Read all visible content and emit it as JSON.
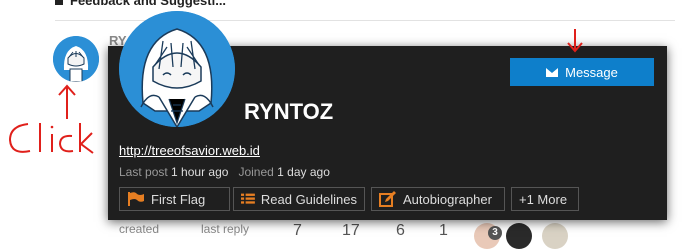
{
  "topic": {
    "title": "Feedback and Suggesti..."
  },
  "background_post": {
    "username_partial": "RY",
    "stats": {
      "created_label": "created",
      "last_reply_label": "last reply",
      "replies": "7",
      "views": "17",
      "users": "6",
      "likes": "1",
      "badge_count": "3"
    }
  },
  "user_card": {
    "username": "RYNTOZ",
    "message_button": "Message",
    "website": "http://treeofsavior.web.id",
    "last_post_label": "Last post",
    "last_post_value": "1 hour ago",
    "joined_label": "Joined",
    "joined_value": "1 day ago",
    "badges": [
      {
        "label": "First Flag",
        "icon": "flag-icon"
      },
      {
        "label": "Read Guidelines",
        "icon": "list-icon"
      },
      {
        "label": "Autobiographer",
        "icon": "edit-icon"
      },
      {
        "label": "+1 More",
        "icon": ""
      }
    ]
  },
  "annotations": {
    "click_text": "Click"
  },
  "colors": {
    "card_bg": "#1f1f1f",
    "accent_blue": "#0e7fcb",
    "badge_orange": "#e67e22",
    "annotation_red": "#e0201b"
  }
}
